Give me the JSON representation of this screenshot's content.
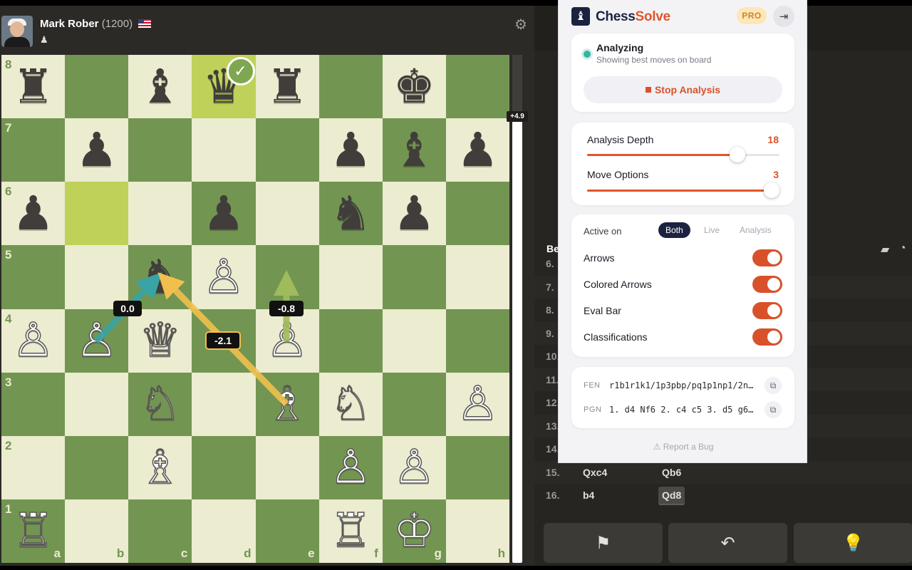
{
  "player": {
    "name": "Mark Rober",
    "rating": "(1200)",
    "captured_icon": "♟"
  },
  "board": {
    "ranks": [
      "8",
      "7",
      "6",
      "5",
      "4",
      "3",
      "2",
      "1"
    ],
    "files": [
      "a",
      "b",
      "c",
      "d",
      "e",
      "f",
      "g",
      "h"
    ],
    "pieces": {
      "a8": "♜",
      "c8": "♝",
      "d8": "♛",
      "e8": "♜",
      "g8": "♚",
      "b7": "♟",
      "f7": "♟",
      "g7": "♝",
      "h7": "♟",
      "a6": "♟",
      "d6": "♟",
      "f6": "♞",
      "g6": "♟",
      "c5": "♞",
      "d5": "♙",
      "a4": "♙",
      "b4": "♙",
      "c4": "♕",
      "e4": "♙",
      "c3": "♘",
      "e3": "♗",
      "f3": "♘",
      "h3": "♙",
      "c2": "♗",
      "f2": "♙",
      "g2": "♙",
      "a1": "♖",
      "f1": "♖",
      "g1": "♔"
    },
    "highlights": [
      "d8",
      "b6"
    ],
    "check_square": "d8",
    "check_symbol": "✓",
    "arrow_labels": [
      "0.0",
      "-2.1",
      "-0.8"
    ]
  },
  "eval": {
    "label": "+4.9",
    "black_fraction": 0.115
  },
  "movelist": {
    "header": "Be",
    "rows": [
      {
        "num": "6.",
        "w": "",
        "b": ""
      },
      {
        "num": "7.",
        "w": "",
        "b": ""
      },
      {
        "num": "8.",
        "w": "",
        "b": ""
      },
      {
        "num": "9.",
        "w": "",
        "b": ""
      },
      {
        "num": "10.",
        "w": "",
        "b": ""
      },
      {
        "num": "11.",
        "w": "",
        "b": ""
      },
      {
        "num": "12.",
        "w": "",
        "b": ""
      },
      {
        "num": "13.",
        "w": "",
        "b": ""
      },
      {
        "num": "14.",
        "w": "",
        "b": ""
      },
      {
        "num": "15.",
        "w": "Qxc4",
        "b": "Qb6"
      },
      {
        "num": "16.",
        "w": "b4",
        "b": "Qd8"
      }
    ]
  },
  "controls": {
    "resign_icon": "⚑",
    "undo_icon": "↶",
    "hint_icon": "💡"
  },
  "extension": {
    "title_a": "Chess",
    "title_b": "Solve",
    "logo_icon": "♝",
    "pro_label": "PRO",
    "logout_icon": "⇥",
    "status_title": "Analyzing",
    "status_sub": "Showing best moves on board",
    "stop_label": "Stop Analysis",
    "depth_label": "Analysis Depth",
    "depth_value": "18",
    "depth_fraction": 0.78,
    "options_label": "Move Options",
    "options_value": "3",
    "options_fraction": 0.96,
    "active_on_label": "Active on",
    "segments": [
      "Both",
      "Live",
      "Analysis"
    ],
    "toggles": [
      "Arrows",
      "Colored Arrows",
      "Eval Bar",
      "Classifications"
    ],
    "fen_key": "FEN",
    "fen_value": "r1b1r1k1/1p3pbp/pq1p1np1/2n…",
    "pgn_key": "PGN",
    "pgn_value": "1. d4 Nf6 2. c4 c5 3. d5 g6…",
    "copy_icon": "⧉",
    "report_label": "Report a Bug",
    "report_icon": "⚠"
  },
  "colors": {
    "light_square": "#ebecd0",
    "dark_square": "#739552",
    "accent": "#e0552a",
    "navy": "#1c2340"
  }
}
